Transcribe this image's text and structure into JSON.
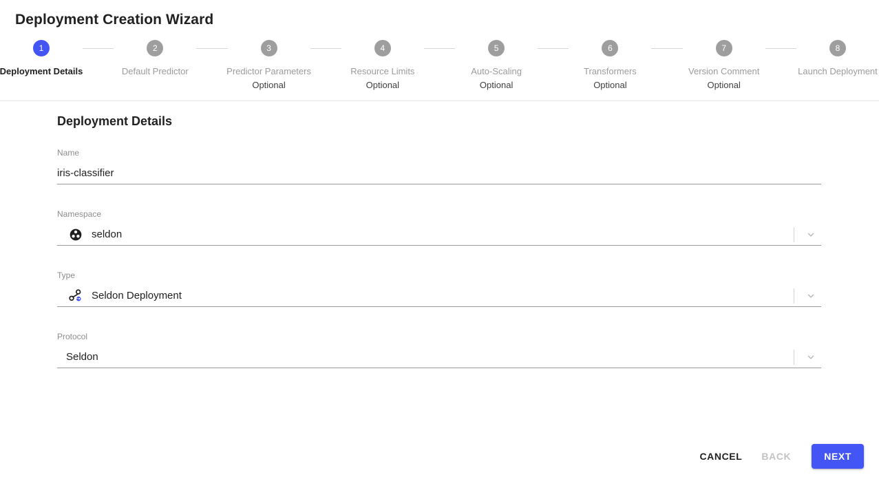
{
  "header": {
    "title": "Deployment Creation Wizard"
  },
  "stepper": {
    "steps": [
      {
        "number": "1",
        "label": "Deployment Details",
        "optional": "",
        "active": true
      },
      {
        "number": "2",
        "label": "Default Predictor",
        "optional": "",
        "active": false
      },
      {
        "number": "3",
        "label": "Predictor Parameters",
        "optional": "Optional",
        "active": false
      },
      {
        "number": "4",
        "label": "Resource Limits",
        "optional": "Optional",
        "active": false
      },
      {
        "number": "5",
        "label": "Auto-Scaling",
        "optional": "Optional",
        "active": false
      },
      {
        "number": "6",
        "label": "Transformers",
        "optional": "Optional",
        "active": false
      },
      {
        "number": "7",
        "label": "Version Comment",
        "optional": "Optional",
        "active": false
      },
      {
        "number": "8",
        "label": "Launch Deployment",
        "optional": "",
        "active": false
      }
    ]
  },
  "form": {
    "heading": "Deployment Details",
    "fields": {
      "name": {
        "label": "Name",
        "value": "iris-classifier"
      },
      "namespace": {
        "label": "Namespace",
        "value": "seldon",
        "icon": "namespace-icon"
      },
      "type": {
        "label": "Type",
        "value": "Seldon Deployment",
        "icon": "seldon-deployment-icon"
      },
      "protocol": {
        "label": "Protocol",
        "value": "Seldon"
      }
    }
  },
  "footer": {
    "cancel_label": "CANCEL",
    "back_label": "BACK",
    "next_label": "NEXT"
  },
  "colors": {
    "accent": "#4355f5",
    "inactive_step": "#9e9e9e",
    "muted_text": "#9b9b9b"
  }
}
